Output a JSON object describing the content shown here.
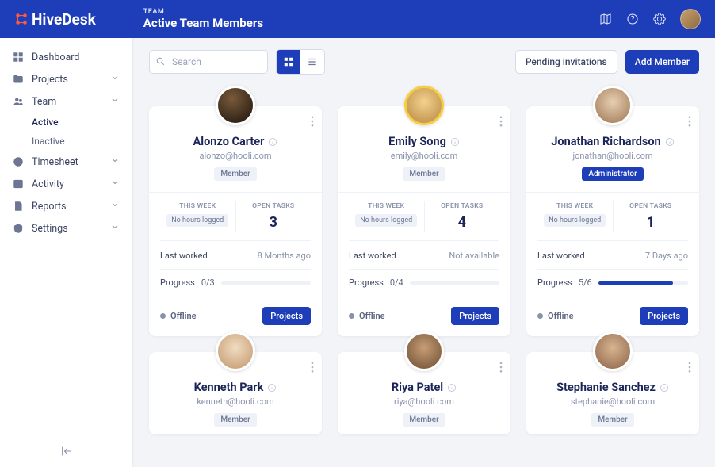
{
  "brand": "HiveDesk",
  "header": {
    "breadcrumb": "TEAM",
    "title": "Active Team Members"
  },
  "sidebar": {
    "items": [
      {
        "icon": "dashboard",
        "label": "Dashboard",
        "expandable": false
      },
      {
        "icon": "folder",
        "label": "Projects",
        "expandable": true
      },
      {
        "icon": "team",
        "label": "Team",
        "expandable": true,
        "expanded": true,
        "children": [
          {
            "label": "Active",
            "active": true
          },
          {
            "label": "Inactive",
            "active": false
          }
        ]
      },
      {
        "icon": "clock",
        "label": "Timesheet",
        "expandable": true
      },
      {
        "icon": "activity",
        "label": "Activity",
        "expandable": true
      },
      {
        "icon": "reports",
        "label": "Reports",
        "expandable": true
      },
      {
        "icon": "settings",
        "label": "Settings",
        "expandable": true
      }
    ]
  },
  "toolbar": {
    "search_placeholder": "Search",
    "pending_label": "Pending invitations",
    "add_label": "Add Member"
  },
  "labels": {
    "this_week": "THIS WEEK",
    "open_tasks": "OPEN TASKS",
    "no_hours": "No hours logged",
    "last_worked": "Last worked",
    "progress": "Progress",
    "offline": "Offline",
    "projects_btn": "Projects"
  },
  "members": [
    {
      "name": "Alonzo Carter",
      "email": "alonzo@hooli.com",
      "role": "Member",
      "role_type": "member",
      "open_tasks": "3",
      "last_worked": "8 Months ago",
      "progress_done": 0,
      "progress_total": 3,
      "status": "Offline",
      "avatar": "av1"
    },
    {
      "name": "Emily Song",
      "email": "emily@hooli.com",
      "role": "Member",
      "role_type": "member",
      "open_tasks": "4",
      "last_worked": "Not available",
      "progress_done": 0,
      "progress_total": 4,
      "status": "Offline",
      "avatar": "av2"
    },
    {
      "name": "Jonathan Richardson",
      "email": "jonathan@hooli.com",
      "role": "Administrator",
      "role_type": "admin",
      "open_tasks": "1",
      "last_worked": "7 Days ago",
      "progress_done": 5,
      "progress_total": 6,
      "status": "Offline",
      "avatar": "av3"
    },
    {
      "name": "Kenneth Park",
      "email": "kenneth@hooli.com",
      "role": "Member",
      "role_type": "member",
      "avatar": "av4"
    },
    {
      "name": "Riya Patel",
      "email": "riya@hooli.com",
      "role": "Member",
      "role_type": "member",
      "avatar": "av5"
    },
    {
      "name": "Stephanie Sanchez",
      "email": "stephanie@hooli.com",
      "role": "Member",
      "role_type": "member",
      "avatar": "av6"
    }
  ]
}
